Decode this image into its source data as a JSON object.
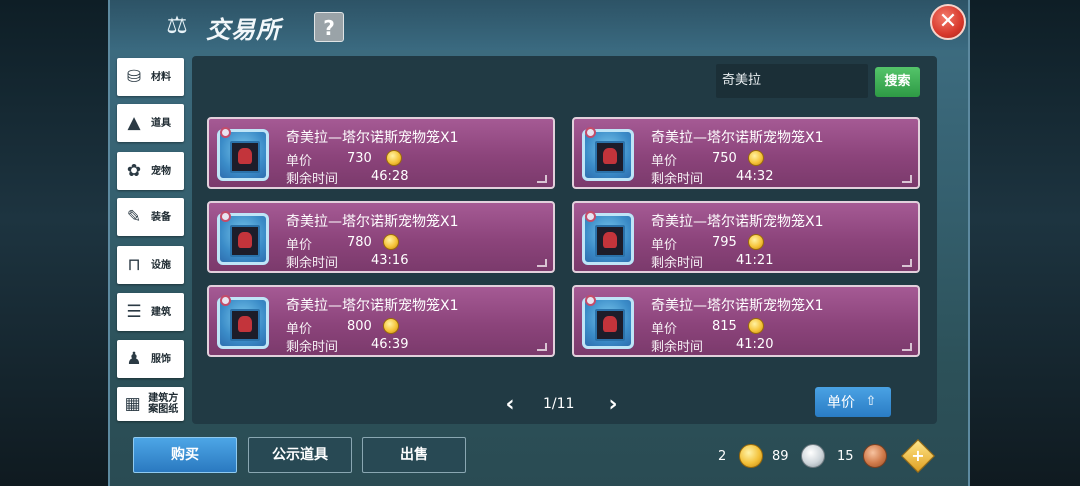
{
  "header": {
    "title": "交易所",
    "help_label": "?",
    "close_label": "✕"
  },
  "categories": [
    {
      "label": "材料",
      "icon": "materials-icon"
    },
    {
      "label": "道具",
      "icon": "item-icon"
    },
    {
      "label": "宠物",
      "icon": "paw-icon"
    },
    {
      "label": "装备",
      "icon": "equipment-icon"
    },
    {
      "label": "设施",
      "icon": "facility-icon"
    },
    {
      "label": "建筑",
      "icon": "building-icon"
    },
    {
      "label": "服饰",
      "icon": "clothing-icon"
    },
    {
      "label": "建筑方案图纸",
      "icon": "blueprint-icon"
    }
  ],
  "search": {
    "value": "奇美拉",
    "button_label": "搜索"
  },
  "listings": [
    {
      "name": "奇美拉—塔尔诺斯宠物笼X1",
      "price_label": "单价",
      "price": "730",
      "time_label": "剩余时间",
      "time": "46:28"
    },
    {
      "name": "奇美拉—塔尔诺斯宠物笼X1",
      "price_label": "单价",
      "price": "750",
      "time_label": "剩余时间",
      "time": "44:32"
    },
    {
      "name": "奇美拉—塔尔诺斯宠物笼X1",
      "price_label": "单价",
      "price": "780",
      "time_label": "剩余时间",
      "time": "43:16"
    },
    {
      "name": "奇美拉—塔尔诺斯宠物笼X1",
      "price_label": "单价",
      "price": "795",
      "time_label": "剩余时间",
      "time": "41:21"
    },
    {
      "name": "奇美拉—塔尔诺斯宠物笼X1",
      "price_label": "单价",
      "price": "800",
      "time_label": "剩余时间",
      "time": "46:39"
    },
    {
      "name": "奇美拉—塔尔诺斯宠物笼X1",
      "price_label": "单价",
      "price": "815",
      "time_label": "剩余时间",
      "time": "41:20"
    }
  ],
  "pagination": {
    "text": "1/11",
    "prev_label": "‹",
    "next_label": "›"
  },
  "sort": {
    "label": "单价"
  },
  "bottom_tabs": [
    {
      "label": "购买",
      "active": true
    },
    {
      "label": "公示道具",
      "active": false
    },
    {
      "label": "出售",
      "active": false
    }
  ],
  "currency": {
    "gold": "2",
    "silver": "89",
    "bronze": "15",
    "add_label": "+"
  },
  "colors": {
    "listing_bg": "#8c447b",
    "search_button": "#3fb055",
    "active_tab": "#3a8fd6"
  }
}
